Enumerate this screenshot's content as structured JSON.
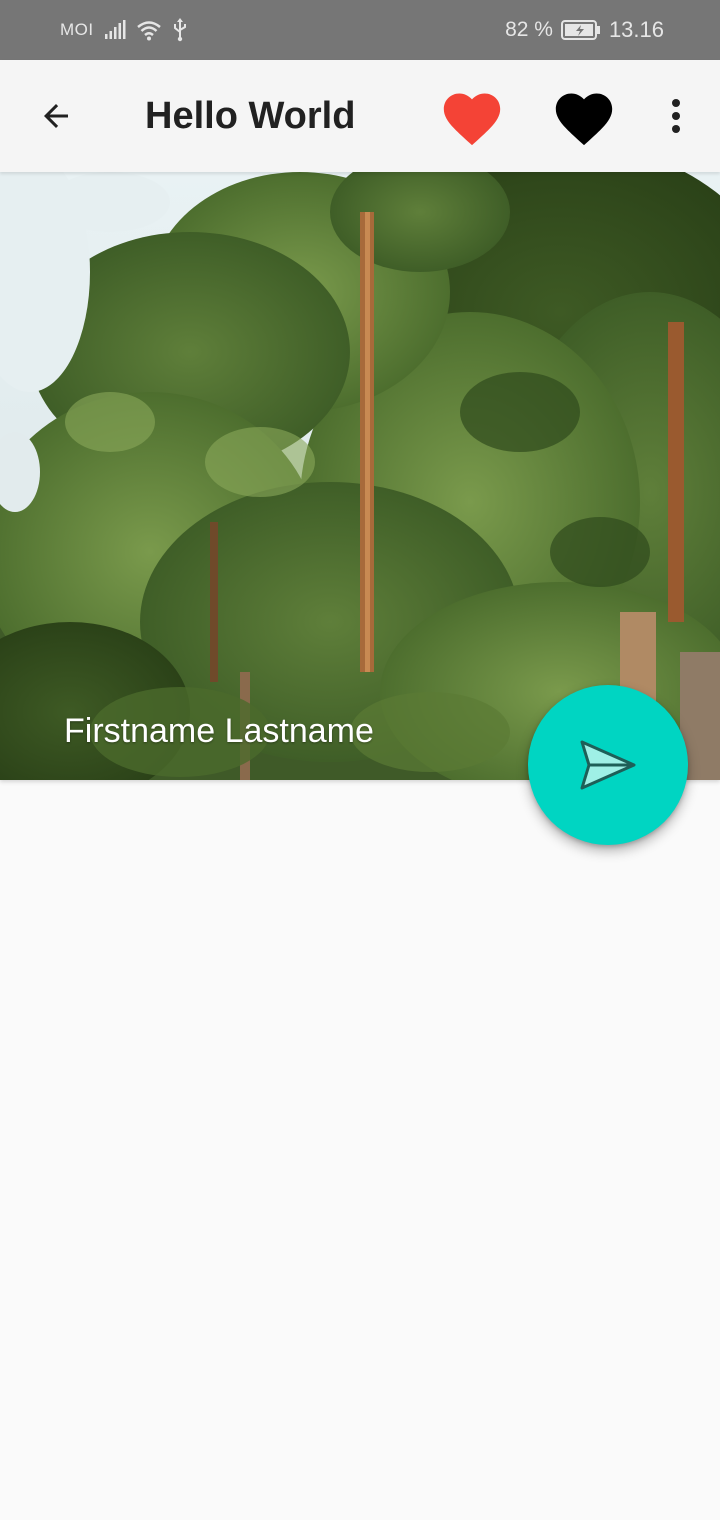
{
  "status_bar": {
    "carrier": "MOI",
    "battery_percent": "82 %",
    "time": "13.16",
    "icons": [
      "signal-icon",
      "wifi-icon",
      "usb-icon",
      "battery-icon"
    ]
  },
  "app_bar": {
    "title": "Hello World",
    "icons": [
      "back-arrow-icon",
      "heart-icon-red",
      "heart-icon-black",
      "more-vert-icon"
    ],
    "colors": {
      "heart_red": "#f44336",
      "heart_black": "#000000",
      "background": "#f5f5f5"
    }
  },
  "header": {
    "image": "pine-trees-photo",
    "caption": "Firstname Lastname"
  },
  "fab": {
    "icon": "send-icon",
    "color": "#00d5c2"
  }
}
